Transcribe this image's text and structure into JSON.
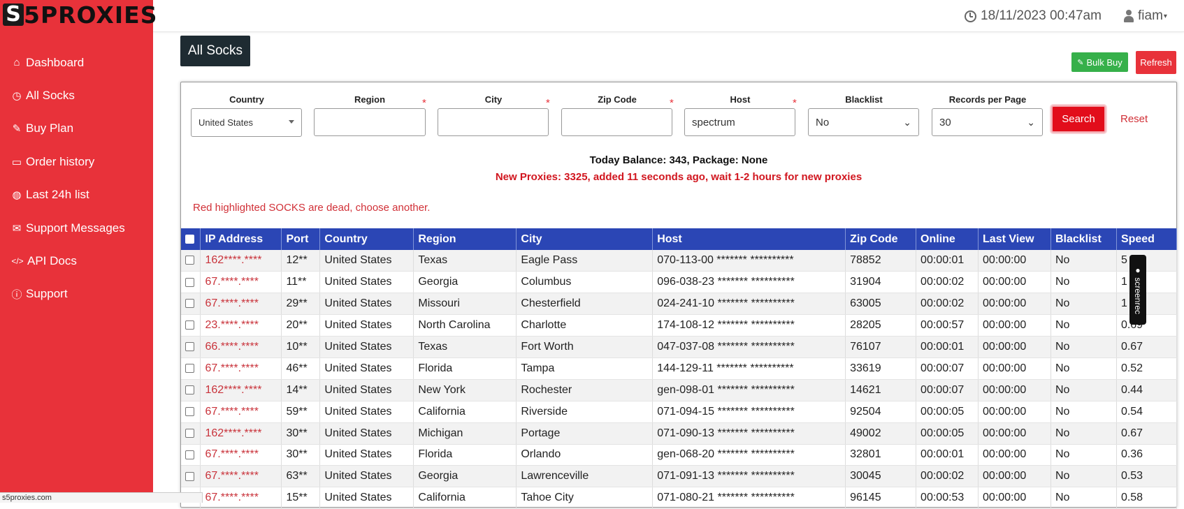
{
  "logo": {
    "mark": "S",
    "text": "5PROXIES"
  },
  "sidebar": {
    "items": [
      {
        "label": "Dashboard",
        "icon": "home-icon",
        "glyph": "⌂"
      },
      {
        "label": "All Socks",
        "icon": "clock-icon",
        "glyph": "◷"
      },
      {
        "label": "Buy Plan",
        "icon": "tag-icon",
        "glyph": "✎"
      },
      {
        "label": "Order history",
        "icon": "credit-card-icon",
        "glyph": "▭"
      },
      {
        "label": "Last 24h list",
        "icon": "globe-icon",
        "glyph": "◍"
      },
      {
        "label": "Support Messages",
        "icon": "envelope-icon",
        "glyph": "✉"
      },
      {
        "label": "API Docs",
        "icon": "code-icon",
        "glyph": "</>"
      },
      {
        "label": "Support",
        "icon": "info-icon",
        "glyph": "ⓘ"
      }
    ]
  },
  "header": {
    "datetime": "18/11/2023 00:47am",
    "username": "fiam"
  },
  "page": {
    "title": "All Socks",
    "bulk_buy": "Bulk Buy",
    "refresh": "Refresh"
  },
  "filters": {
    "country": {
      "label": "Country",
      "value": "United States"
    },
    "region": {
      "label": "Region",
      "value": ""
    },
    "city": {
      "label": "City",
      "value": ""
    },
    "zip": {
      "label": "Zip Code",
      "value": ""
    },
    "host": {
      "label": "Host",
      "value": "spectrum"
    },
    "blacklist": {
      "label": "Blacklist",
      "value": "No"
    },
    "records": {
      "label": "Records per Page",
      "value": "30"
    },
    "required_mark": "*",
    "search": "Search",
    "reset": "Reset"
  },
  "info": {
    "balance": "Today Balance: 343, Package: None",
    "new_proxies": "New Proxies: 3325, added 11 seconds ago, wait 1-2 hours for new proxies",
    "dead_note": "Red highlighted SOCKS are dead, choose another."
  },
  "table": {
    "columns": [
      "IP Address",
      "Port",
      "Country",
      "Region",
      "City",
      "Host",
      "Zip Code",
      "Online",
      "Last View",
      "Blacklist",
      "Speed"
    ],
    "rows": [
      [
        "162****.****",
        "12**",
        "United States",
        "Texas",
        "Eagle Pass",
        "070-113-00 ******* **********",
        "78852",
        "00:00:01",
        "00:00:00",
        "No",
        "5"
      ],
      [
        "67.****.****",
        "11**",
        "United States",
        "Georgia",
        "Columbus",
        "096-038-23 ******* **********",
        "31904",
        "00:00:02",
        "00:00:00",
        "No",
        "1"
      ],
      [
        "67.****.****",
        "29**",
        "United States",
        "Missouri",
        "Chesterfield",
        "024-241-10 ******* **********",
        "63005",
        "00:00:02",
        "00:00:00",
        "No",
        "1"
      ],
      [
        "23.****.****",
        "20**",
        "United States",
        "North Carolina",
        "Charlotte",
        "174-108-12 ******* **********",
        "28205",
        "00:00:57",
        "00:00:00",
        "No",
        "0.69"
      ],
      [
        "66.****.****",
        "10**",
        "United States",
        "Texas",
        "Fort Worth",
        "047-037-08 ******* **********",
        "76107",
        "00:00:01",
        "00:00:00",
        "No",
        "0.67"
      ],
      [
        "67.****.****",
        "46**",
        "United States",
        "Florida",
        "Tampa",
        "144-129-11 ******* **********",
        "33619",
        "00:00:07",
        "00:00:00",
        "No",
        "0.52"
      ],
      [
        "162****.****",
        "14**",
        "United States",
        "New York",
        "Rochester",
        "gen-098-01 ******* **********",
        "14621",
        "00:00:07",
        "00:00:00",
        "No",
        "0.44"
      ],
      [
        "67.****.****",
        "59**",
        "United States",
        "California",
        "Riverside",
        "071-094-15 ******* **********",
        "92504",
        "00:00:05",
        "00:00:00",
        "No",
        "0.54"
      ],
      [
        "162****.****",
        "30**",
        "United States",
        "Michigan",
        "Portage",
        "071-090-13 ******* **********",
        "49002",
        "00:00:05",
        "00:00:00",
        "No",
        "0.67"
      ],
      [
        "67.****.****",
        "30**",
        "United States",
        "Florida",
        "Orlando",
        "gen-068-20 ******* **********",
        "32801",
        "00:00:01",
        "00:00:00",
        "No",
        "0.36"
      ],
      [
        "67.****.****",
        "63**",
        "United States",
        "Georgia",
        "Lawrenceville",
        "071-091-13 ******* **********",
        "30045",
        "00:00:02",
        "00:00:00",
        "No",
        "0.53"
      ],
      [
        "67.****.****",
        "15**",
        "United States",
        "California",
        "Tahoe City",
        "071-080-21 ******* **********",
        "96145",
        "00:00:53",
        "00:00:00",
        "No",
        "0.58"
      ]
    ]
  },
  "statusbar": {
    "url": "s5proxies.com"
  },
  "overlay": {
    "watermark": "● screenrec"
  }
}
